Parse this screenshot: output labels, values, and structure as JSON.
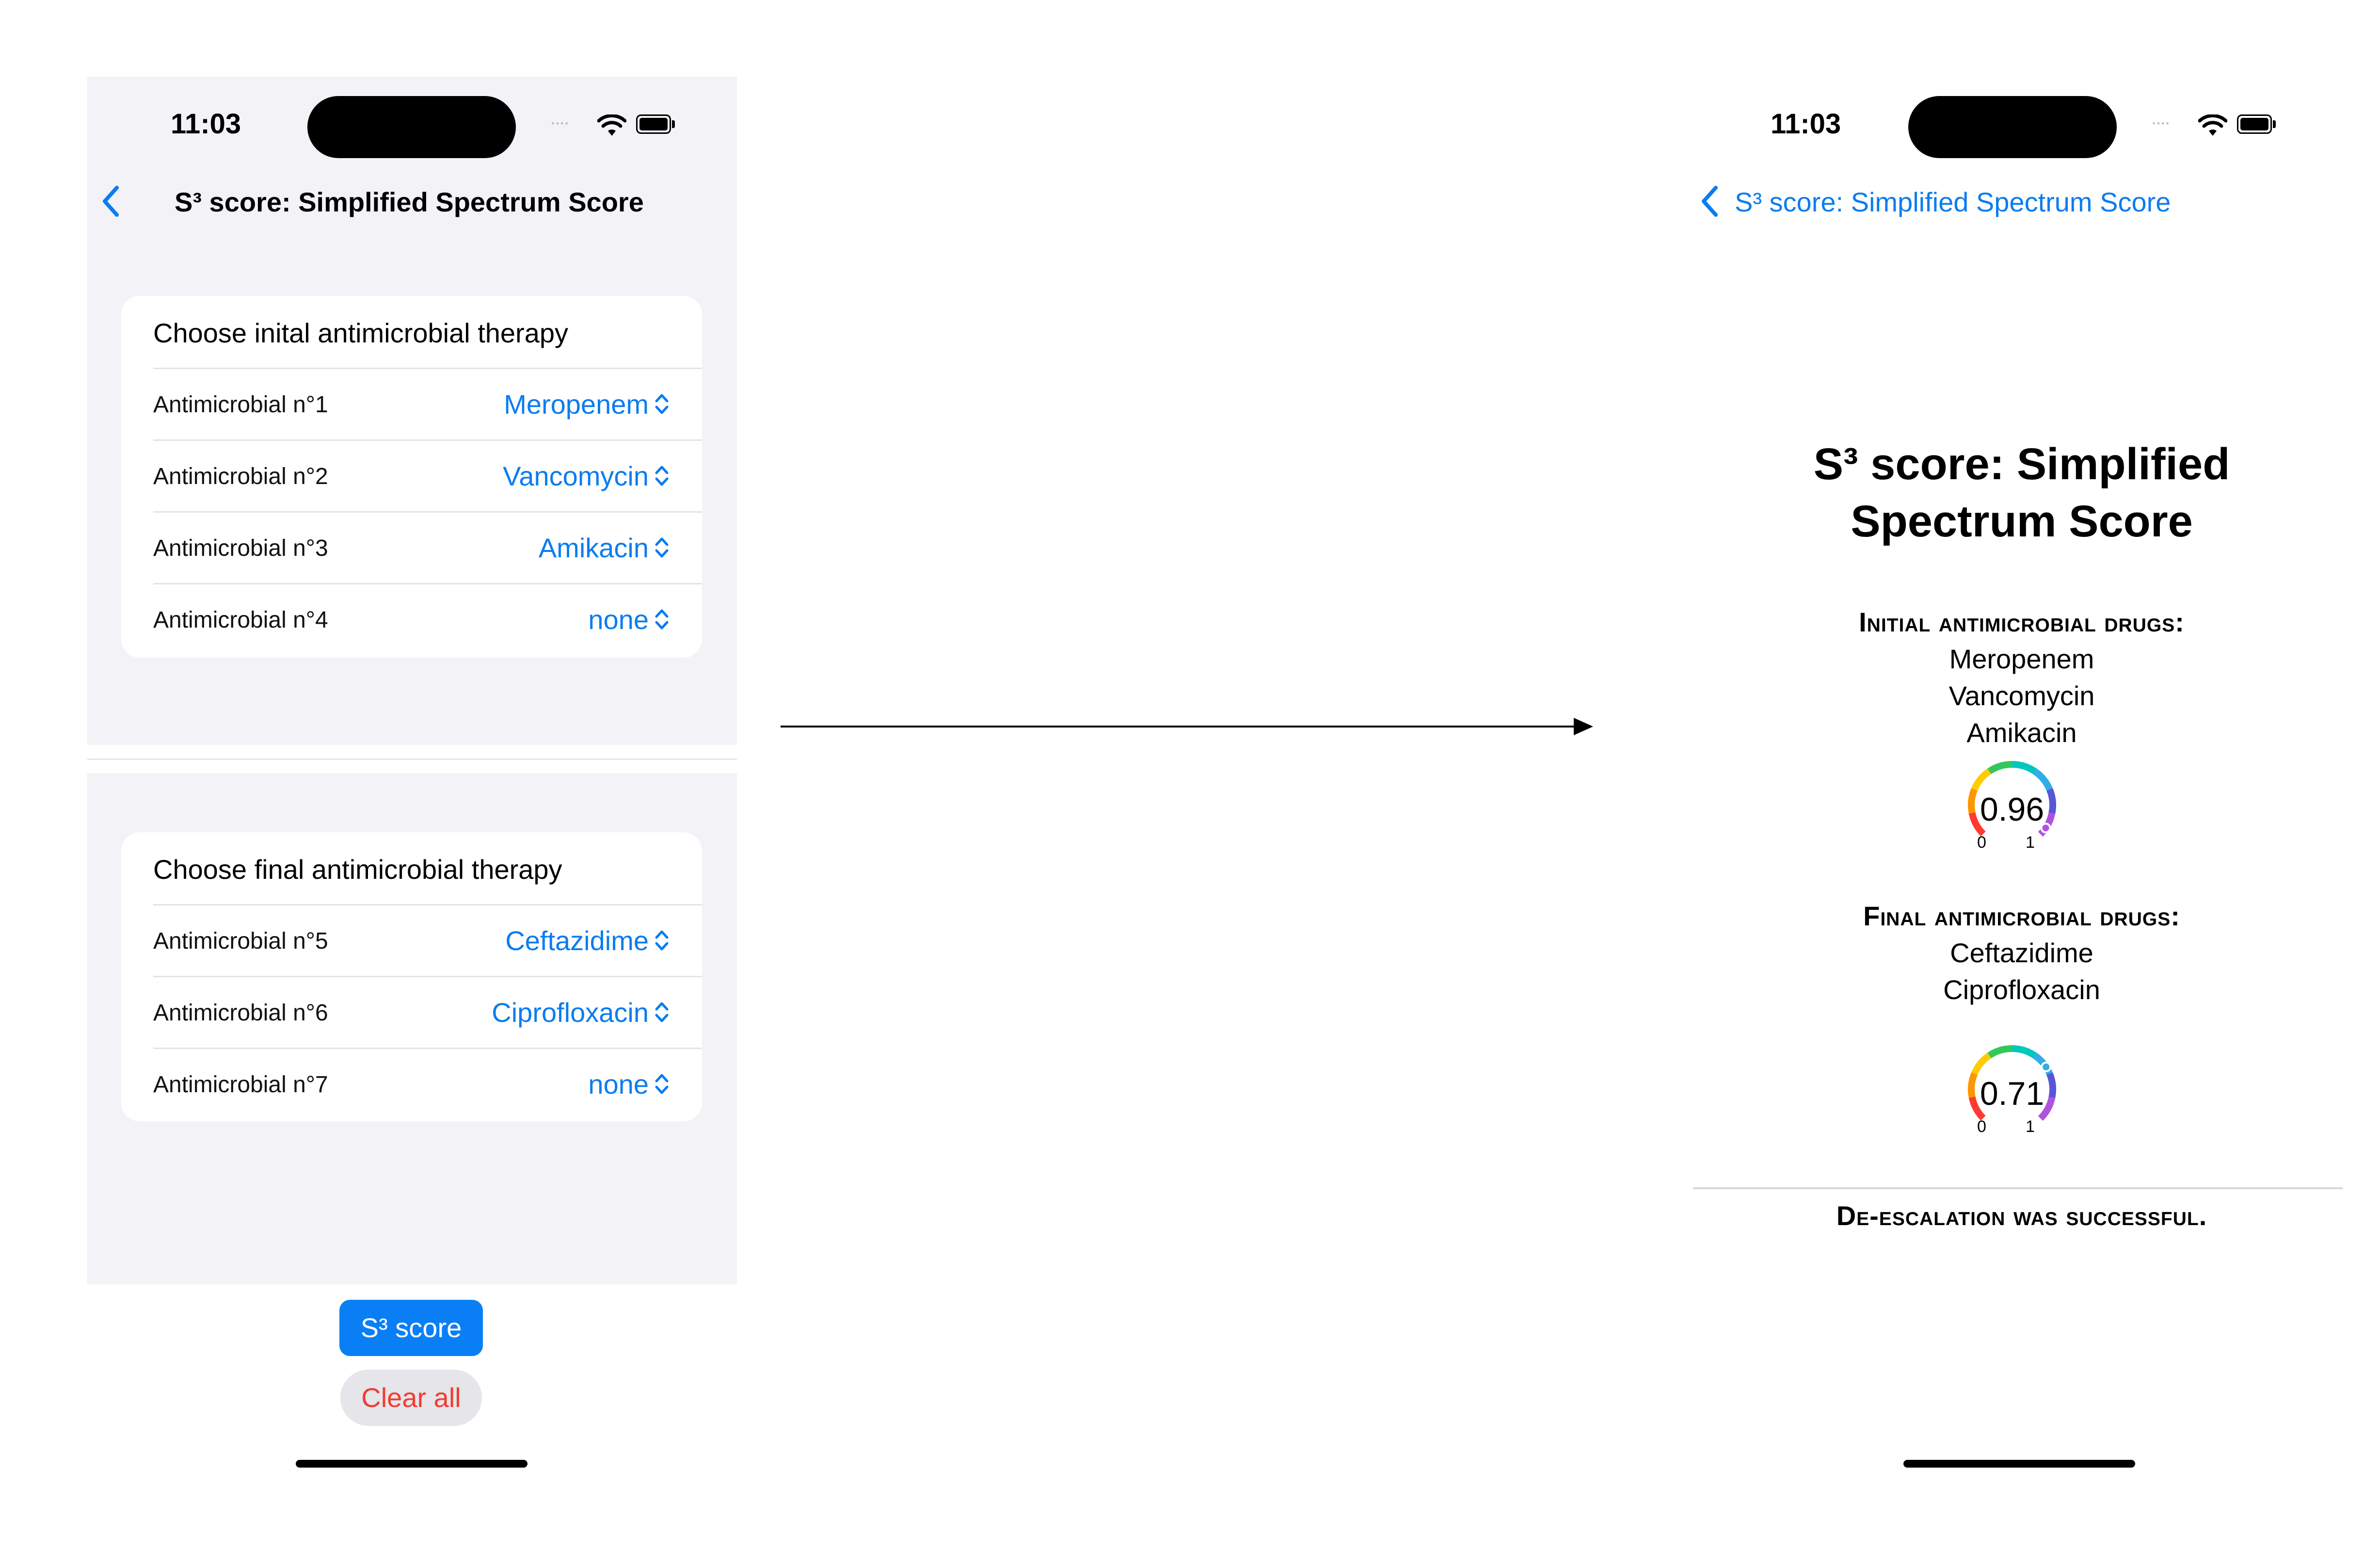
{
  "left": {
    "status": {
      "time": "11:03",
      "signal": "····"
    },
    "nav": {
      "title": "S³ score: Simplified Spectrum Score"
    },
    "initial": {
      "header": "Choose inital antimicrobial therapy",
      "rows": [
        {
          "label": "Antimicrobial n°1",
          "value": "Meropenem"
        },
        {
          "label": "Antimicrobial n°2",
          "value": "Vancomycin"
        },
        {
          "label": "Antimicrobial n°3",
          "value": "Amikacin"
        },
        {
          "label": "Antimicrobial n°4",
          "value": "none"
        }
      ]
    },
    "final": {
      "header": "Choose final antimicrobial therapy",
      "rows": [
        {
          "label": "Antimicrobial n°5",
          "value": "Ceftazidime"
        },
        {
          "label": "Antimicrobial n°6",
          "value": "Ciprofloxacin"
        },
        {
          "label": "Antimicrobial n°7",
          "value": "none"
        }
      ]
    },
    "buttons": {
      "score": "S³ score",
      "clear": "Clear all"
    }
  },
  "right": {
    "status": {
      "time": "11:03",
      "signal": "····"
    },
    "nav": {
      "back_label": "S³ score: Simplified Spectrum Score"
    },
    "title_line1": "S³ score: Simplified",
    "title_line2": "Spectrum Score",
    "initial_heading": "Initial antimicrobial drugs:",
    "initial_drugs": [
      "Meropenem",
      "Vancomycin",
      "Amikacin"
    ],
    "initial_gauge": {
      "value": "0.96",
      "min": "0",
      "max": "1",
      "fraction": 0.96
    },
    "final_heading": "Final antimicrobial drugs:",
    "final_drugs": [
      "Ceftazidime",
      "Ciprofloxacin"
    ],
    "final_gauge": {
      "value": "0.71",
      "min": "0",
      "max": "1",
      "fraction": 0.71
    },
    "result": "De-escalation was successful."
  },
  "icons": [
    "chevron-left-icon",
    "chevron-up-down-icon",
    "wifi-icon",
    "battery-icon",
    "arrow-right-icon"
  ],
  "colors": {
    "accent": "#0a7cf0",
    "button": "#0a7ff5",
    "destructive": "#f23b30",
    "grouped_bg": "#f2f2f7"
  }
}
